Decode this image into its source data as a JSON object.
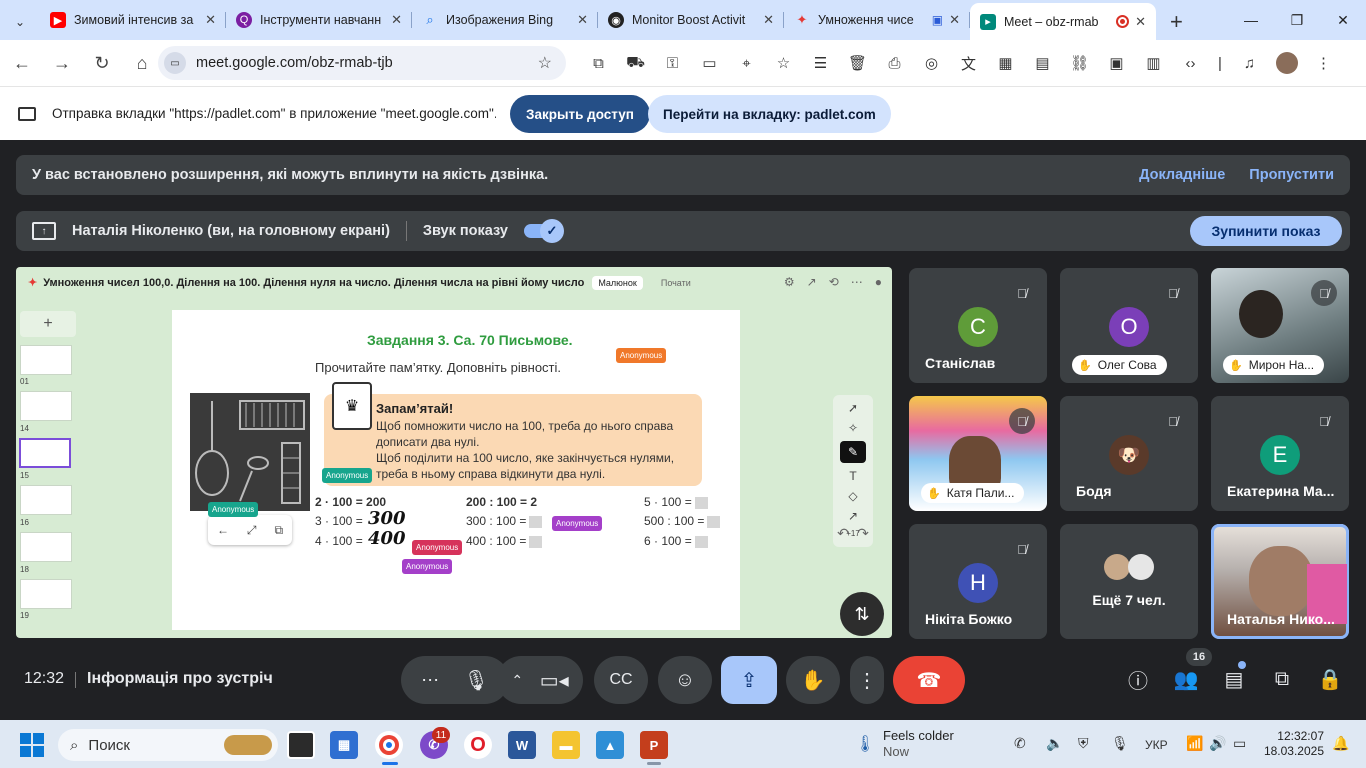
{
  "browser": {
    "tabs": [
      {
        "title": "Зимовий інтенсив за",
        "favicon_color": "#ff0000",
        "icon": "youtube-icon"
      },
      {
        "title": "Інструменти навчанн",
        "favicon_color": "#7b1fa2",
        "icon": "quizlet-icon"
      },
      {
        "title": "Изображения Bing",
        "favicon_color": "#1a73e8",
        "icon": "search-icon"
      },
      {
        "title": "Monitor Boost Activit",
        "favicon_color": "#222222",
        "icon": "monitor-boost-icon"
      },
      {
        "title": "Умноження чисе",
        "favicon_color": "#e53935",
        "icon": "padlet-icon"
      },
      {
        "title": "Meet – obz-rmab",
        "favicon_color": "#00897b",
        "icon": "meet-icon",
        "active": true
      }
    ],
    "new_tab": "+",
    "url": "meet.google.com/obz-rmab-tjb"
  },
  "infobar": {
    "text": "Отправка вкладки \"https://padlet.com\" в приложение \"meet.google.com\"...",
    "stop_access": "Закрыть доступ",
    "goto_tab": "Перейти на вкладку: padlet.com"
  },
  "notice": {
    "text": "У вас встановлено розширення, які можуть вплинути на якість дзвінка.",
    "learn_more": "Докладніше",
    "skip": "Пропустити"
  },
  "presenting": {
    "presenter": "Наталія Ніколенко (ви, на головному екрані)",
    "sound_label": "Звук показу",
    "sound_on": true,
    "stop_button": "Зупинити показ"
  },
  "shared_screen": {
    "board_title": "Умноження чисел 100,0. Ділення на 100. Ділення нуля на число. Ділення числа на рівні йому число",
    "chip": "Малюнок",
    "chip2": "Почати",
    "slide_numbers": [
      "01",
      "14",
      "15",
      "16",
      "18",
      "19"
    ],
    "task_title": "Завдання 3. Са. 70 Письмове.",
    "task_sub": "Прочитайте пам’ятку. Доповніть рівності.",
    "memo_title": "Запам’ятай!",
    "memo_lines": [
      "Щоб помножити число на 100, треба до нього справа дописати два нулі.",
      "Щоб поділити на 100 число, яке закінчується нулями, треба в ньому справа відкинути два нулі."
    ],
    "equations": {
      "col1": [
        "2 · 100 = 200",
        "3 · 100 =",
        "4 · 100 ="
      ],
      "col1_handwritten": [
        "300",
        "400"
      ],
      "col2": [
        "200 : 100 = 2",
        "300 : 100 =",
        "400 : 100 ="
      ],
      "col3": [
        "5 · 100 =",
        "500 : 100 =",
        "6 · 100 ="
      ]
    },
    "anonymous_label": "Anonymous",
    "tool_plus_count": "+17"
  },
  "participants": [
    {
      "name": "Станіслав",
      "initial": "С",
      "avatar_color": "#5f9c39",
      "style": "plain",
      "muted": true
    },
    {
      "name": "Олег Сова",
      "initial": "О",
      "avatar_color": "#7b3fb8",
      "style": "pill",
      "muted": true
    },
    {
      "name": "Мирон На...",
      "style": "pill-photo",
      "muted": true
    },
    {
      "name": "Катя Пали...",
      "style": "pill-photo",
      "muted": true
    },
    {
      "name": "Бодя",
      "style": "plain-photo-avatar",
      "muted": true
    },
    {
      "name": "Екатерина Ма...",
      "initial": "E",
      "avatar_color": "#0f9d7a",
      "style": "plain",
      "muted": true
    },
    {
      "name": "Нікіта Божко",
      "initial": "Н",
      "avatar_color": "#3f51b5",
      "style": "plain",
      "muted": true
    },
    {
      "name": "Ещё 7 чел.",
      "style": "more"
    },
    {
      "name": "Наталья Нико...",
      "style": "self-photo",
      "active": true
    }
  ],
  "controls": {
    "time": "12:32",
    "meeting_info": "Інформація про зустріч",
    "people_count": "16"
  },
  "taskbar": {
    "search": "Поиск",
    "viber_badge": "11",
    "weather_title": "Feels colder",
    "weather_sub": "Now",
    "language": "УКР",
    "time": "12:32:07",
    "date": "18.03.2025"
  },
  "colors": {
    "meet_bg": "#202124",
    "surface": "#3c4043",
    "accent": "#a8c7fa",
    "end_call": "#ea4335",
    "link": "#8ab4f8"
  }
}
